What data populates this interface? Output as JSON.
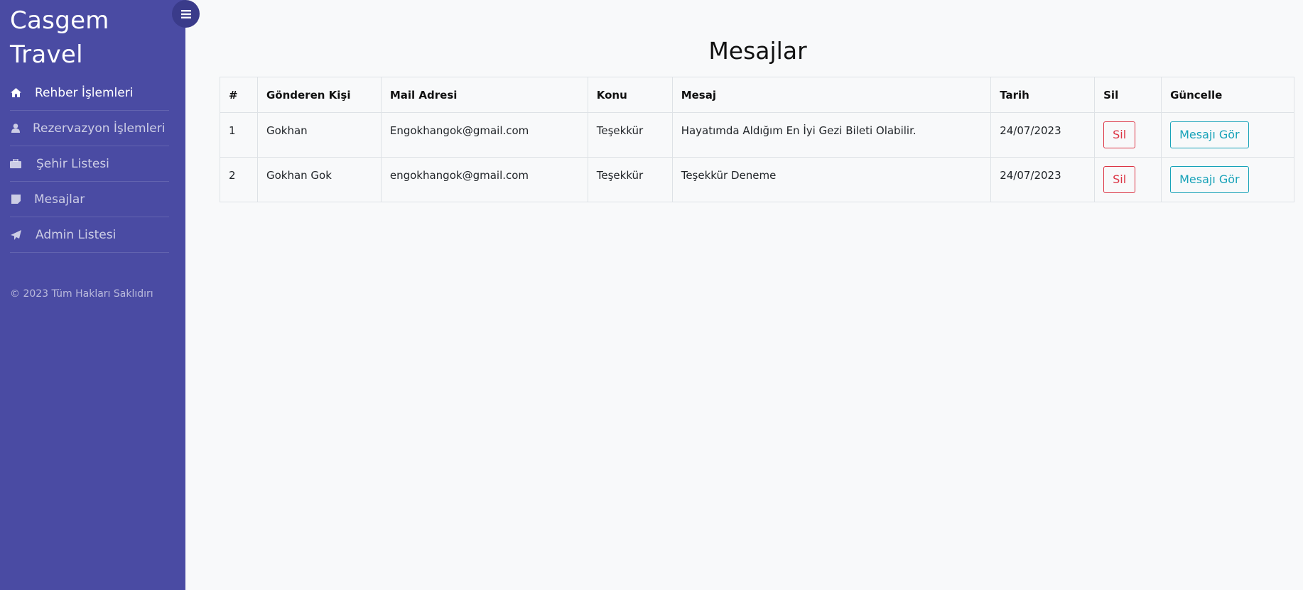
{
  "sidebar": {
    "brand": "Casgem Travel",
    "items": [
      {
        "label": "Rehber İşlemleri",
        "icon": "home-icon"
      },
      {
        "label": "Rezervazyon İşlemleri",
        "icon": "user-icon"
      },
      {
        "label": "Şehir Listesi",
        "icon": "briefcase-icon"
      },
      {
        "label": "Mesajlar",
        "icon": "note-icon"
      },
      {
        "label": "Admin Listesi",
        "icon": "paper-plane-icon"
      }
    ],
    "footer": "© 2023 Tüm Hakları Saklıdırı",
    "colors": {
      "background": "#4a4ba3",
      "toggle": "#3a3b8a"
    }
  },
  "main": {
    "title": "Mesajlar",
    "table": {
      "headers": [
        "#",
        "Gönderen Kişi",
        "Mail Adresi",
        "Konu",
        "Mesaj",
        "Tarih",
        "Sil",
        "Güncelle"
      ],
      "rows": [
        {
          "id": "1",
          "sender": "Gokhan",
          "email": "Engokhangok@gmail.com",
          "subject": "Teşekkür",
          "message": "Hayatımda Aldığım En İyi Gezi Bileti Olabilir.",
          "date": "24/07/2023",
          "delete_label": "Sil",
          "view_label": "Mesajı Gör"
        },
        {
          "id": "2",
          "sender": "Gokhan Gok",
          "email": "engokhangok@gmail.com",
          "subject": "Teşekkür",
          "message": "Teşekkür Deneme",
          "date": "24/07/2023",
          "delete_label": "Sil",
          "view_label": "Mesajı Gör"
        }
      ]
    },
    "colors": {
      "danger": "#dc3545",
      "info": "#17a2b8"
    }
  }
}
